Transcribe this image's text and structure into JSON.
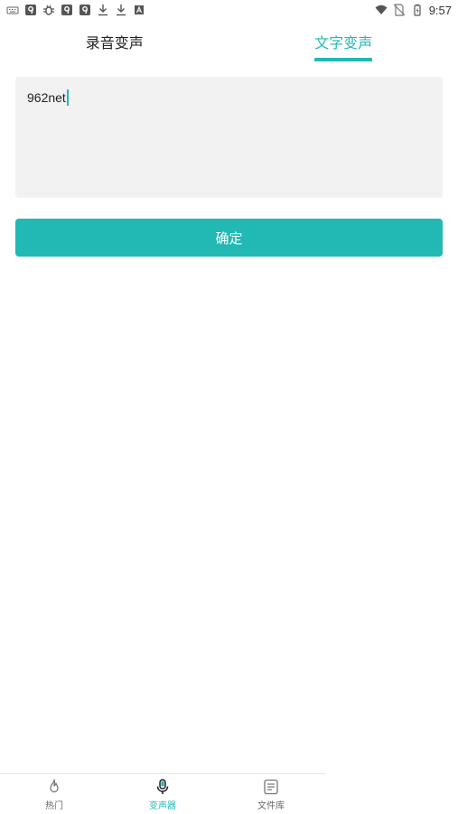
{
  "status_bar": {
    "left_icons": [
      "keyboard-icon",
      "app-9-icon",
      "bug-icon",
      "app-9-icon",
      "app-9-icon",
      "download-icon",
      "download-icon",
      "font-a-icon"
    ],
    "right_icons": [
      "wifi-icon",
      "no-sim-icon",
      "battery-charging-icon"
    ],
    "time": "9:57"
  },
  "tabs": [
    {
      "label": "录音变声",
      "active": false
    },
    {
      "label": "文字变声",
      "active": true
    }
  ],
  "text_input": {
    "value": "962net"
  },
  "confirm_button": {
    "label": "确定"
  },
  "bottom_nav": {
    "items": [
      {
        "label": "热门",
        "icon": "flame-icon",
        "active": false
      },
      {
        "label": "变声器",
        "icon": "microphone-icon",
        "active": true
      },
      {
        "label": "文件库",
        "icon": "document-icon",
        "active": false
      }
    ]
  },
  "colors": {
    "accent": "#22b8b3",
    "input_bg": "#f2f2f2",
    "text": "#222222"
  }
}
